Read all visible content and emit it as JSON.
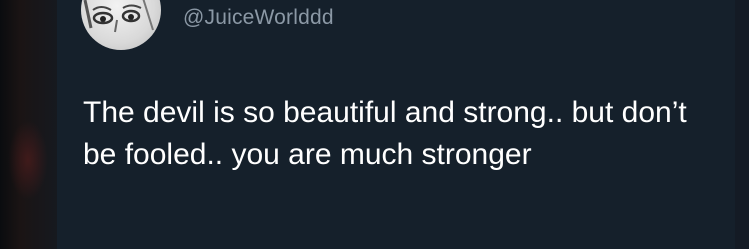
{
  "tweet": {
    "handle": "@JuiceWorlddd",
    "text": "The devil is so beautiful and strong.. but don’t be fooled.. you are much stronger"
  },
  "colors": {
    "background": "#15202b",
    "handle": "#8b98a5",
    "text": "#ffffff"
  }
}
